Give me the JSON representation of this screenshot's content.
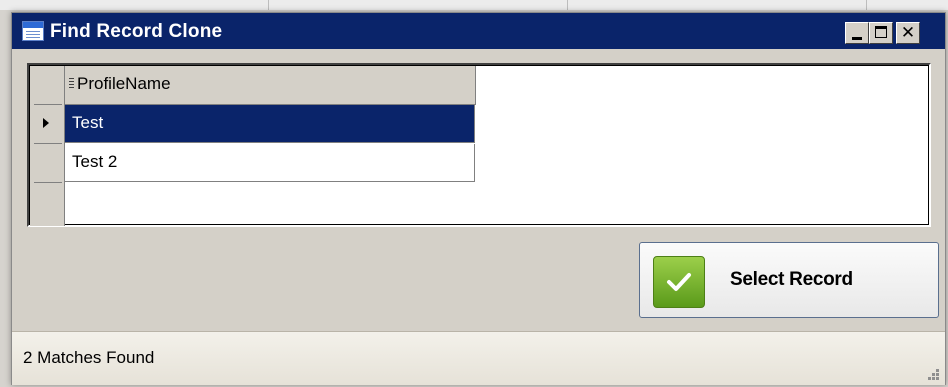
{
  "window": {
    "title": "Find Record Clone",
    "title_icon": "table-form-icon",
    "controls": {
      "minimize": "minimize-icon",
      "maximize": "maximize-icon",
      "close_glyph": "✕"
    }
  },
  "grid": {
    "columns": [
      {
        "label": "ProfileName"
      }
    ],
    "rows": [
      {
        "profile_name": "Test",
        "selected": true
      },
      {
        "profile_name": "Test 2",
        "selected": false
      }
    ]
  },
  "actions": {
    "select_record_label": "Select Record",
    "select_record_icon": "checkmark-icon"
  },
  "status": {
    "text": "2 Matches Found"
  },
  "colors": {
    "titlebar": "#0a246a",
    "selection": "#0a246a",
    "check_green": "#6ab023",
    "window_bg": "#d4d0c8"
  }
}
